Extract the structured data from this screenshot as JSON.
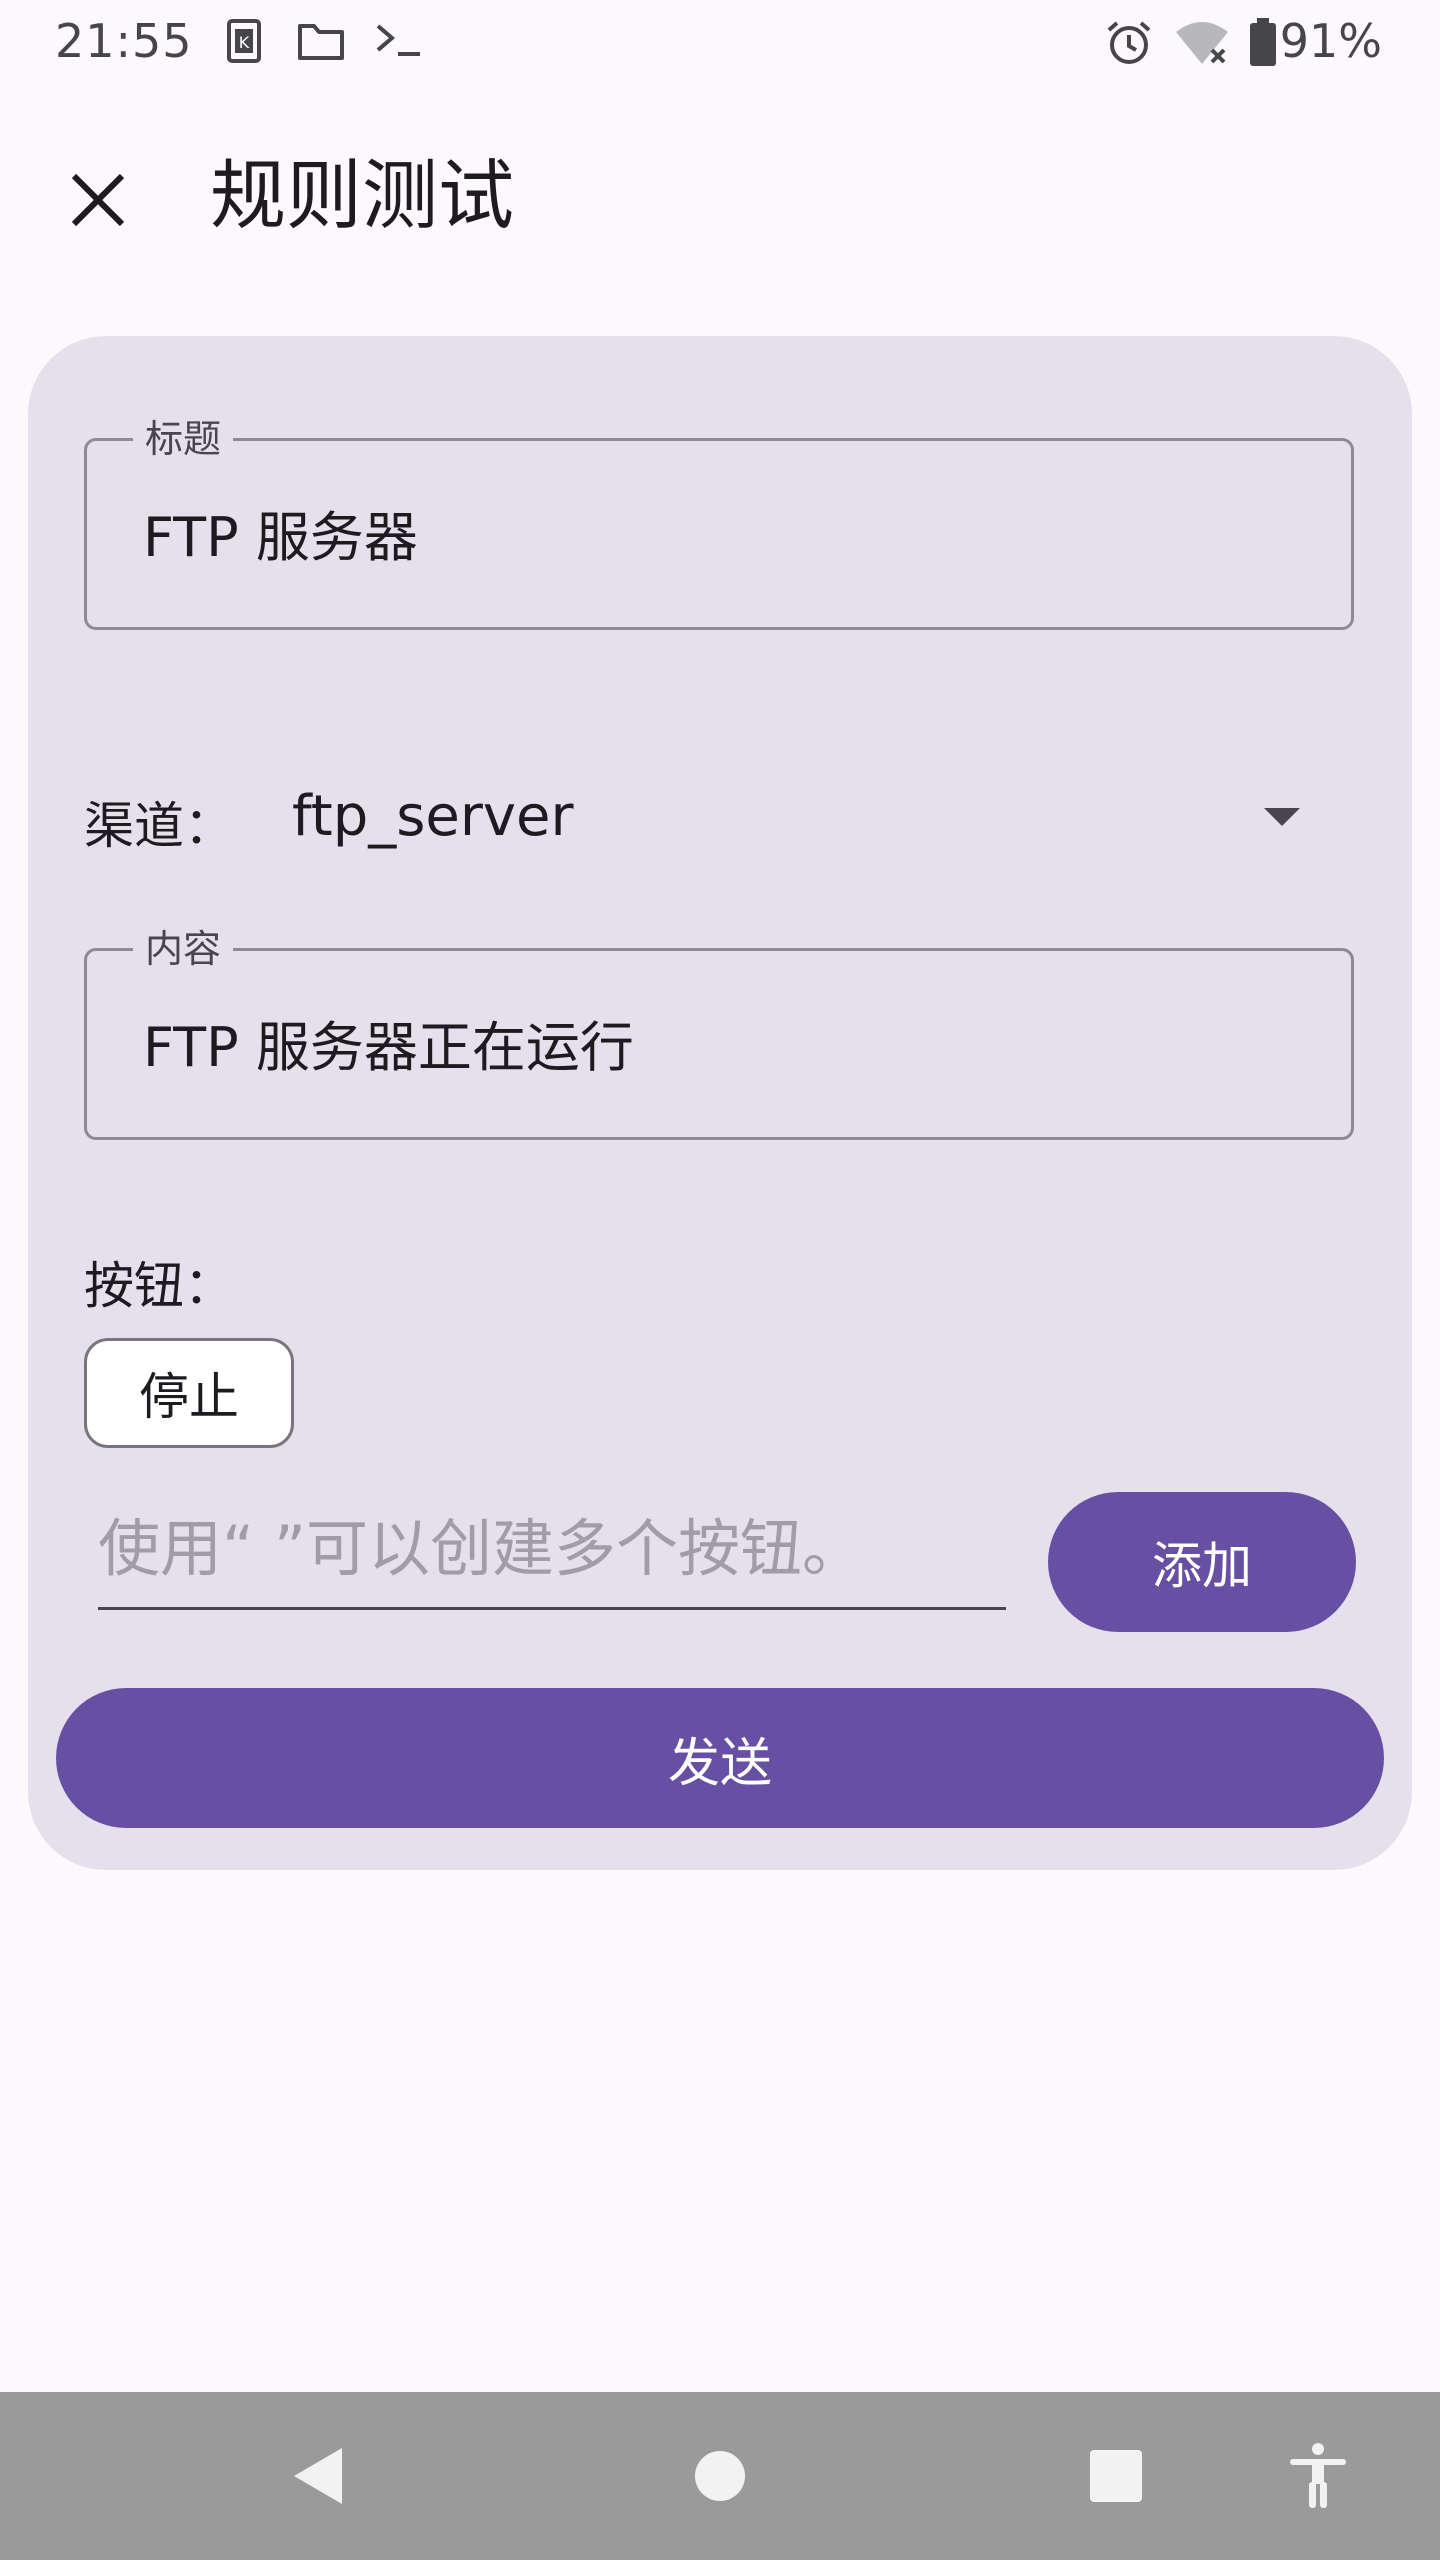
{
  "status_bar": {
    "time": "21:55",
    "battery_percent": "91%",
    "left_icons": [
      "keyboard-k-icon",
      "folder-icon",
      "terminal-icon"
    ],
    "right_icons": [
      "alarm-icon",
      "wifi-off-icon",
      "battery-icon"
    ]
  },
  "app_bar": {
    "title": "规则测试",
    "close_icon": "close-icon"
  },
  "form": {
    "title_field": {
      "label": "标题",
      "value": "FTP 服务器"
    },
    "channel": {
      "label": "渠道：",
      "value": "ftp_server"
    },
    "content_field": {
      "label": "内容",
      "value": "FTP 服务器正在运行"
    },
    "buttons": {
      "label": "按钮：",
      "items": [
        "停止"
      ],
      "input_placeholder": "使用“ ”可以创建多个按钮。",
      "add_label": "添加"
    },
    "send_label": "发送"
  },
  "colors": {
    "primary": "#6750a4",
    "card_bg": "#e6e0ec",
    "page_bg": "#fdf8fc",
    "nav_bar": "#9a9a9a"
  },
  "nav_bar": {
    "icons": [
      "back-icon",
      "home-icon",
      "recents-icon",
      "accessibility-icon"
    ]
  }
}
